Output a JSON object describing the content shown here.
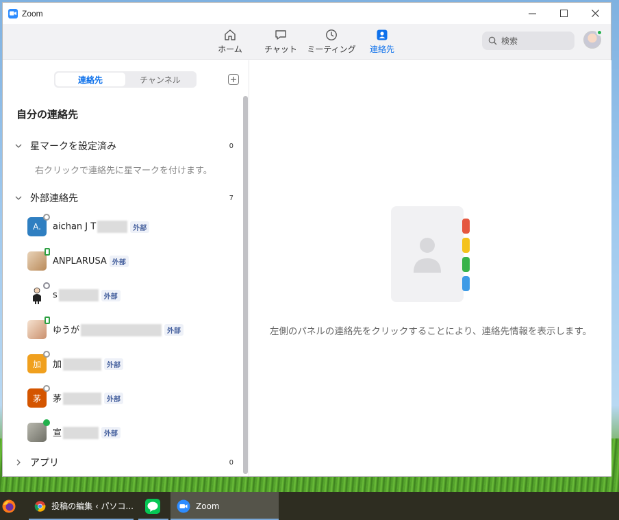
{
  "window": {
    "title": "Zoom"
  },
  "nav": {
    "tabs": [
      {
        "label": "ホーム",
        "icon": "home-icon"
      },
      {
        "label": "チャット",
        "icon": "chat-icon"
      },
      {
        "label": "ミーティング",
        "icon": "clock-icon"
      },
      {
        "label": "連絡先",
        "icon": "contacts-icon",
        "active": true
      }
    ],
    "search_label": "検索"
  },
  "sidebar": {
    "segments": [
      "連絡先",
      "チャンネル"
    ],
    "heading": "自分の連絡先",
    "groups": [
      {
        "name": "星マークを設定済み",
        "count": "0",
        "expanded": true
      },
      {
        "name": "外部連絡先",
        "count": "7",
        "expanded": true
      },
      {
        "name": "アプリ",
        "count": "0",
        "expanded": false
      }
    ],
    "starred_hint": "右クリックで連絡先に星マークを付けます。",
    "contacts": [
      {
        "avatar_text": "A.",
        "name": "aichan J T",
        "badge": "外部",
        "status": "away",
        "avatar_color": "#2f7fc1"
      },
      {
        "avatar_text": "",
        "name": "ANPLARUSA",
        "badge": "外部",
        "status": "phone",
        "avatar_color": "#c9a27a"
      },
      {
        "avatar_text": "",
        "name": "s",
        "badge": "外部",
        "status": "clock",
        "avatar_color": "#ffffff"
      },
      {
        "avatar_text": "",
        "name": "ゆうが",
        "badge": "外部",
        "status": "phone",
        "avatar_color": "#e8c8b0"
      },
      {
        "avatar_text": "加",
        "name": "加",
        "badge": "外部",
        "status": "away",
        "avatar_color": "#f0a01e"
      },
      {
        "avatar_text": "茅",
        "name": "茅",
        "badge": "外部",
        "status": "away",
        "avatar_color": "#d45500"
      },
      {
        "avatar_text": "",
        "name": "宣",
        "badge": "外部",
        "status": "online",
        "avatar_color": "#8a8a84"
      }
    ]
  },
  "main": {
    "empty_message": "左側のパネルの連絡先をクリックすることにより、連絡先情報を表示します。"
  },
  "taskbar": {
    "items": [
      {
        "label": "",
        "icon": "firefox-icon"
      },
      {
        "label": "投稿の編集 ‹ パソコ...",
        "icon": "chrome-icon"
      },
      {
        "label": "",
        "icon": "line-icon"
      },
      {
        "label": "Zoom",
        "icon": "zoom-icon",
        "active": true
      }
    ]
  }
}
